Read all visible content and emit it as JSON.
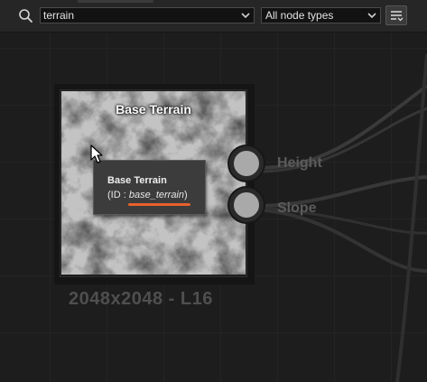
{
  "toolbar": {
    "search": {
      "value": "terrain",
      "icon": "search-icon"
    },
    "node_type_filter": {
      "selected": "All node types"
    },
    "filter_options_icon": "filter-list-icon"
  },
  "graph": {
    "node": {
      "title": "Base Terrain",
      "resolution": "2048x2048 - L16",
      "ports": [
        {
          "label": "Height"
        },
        {
          "label": "Slope"
        }
      ]
    },
    "tooltip": {
      "title": "Base Terrain",
      "id_prefix": "(ID : ",
      "id_value": "base_terrain",
      "id_suffix": ")",
      "highlight_color": "#e8612c"
    }
  },
  "colors": {
    "background": "#1d1d1d",
    "toolbar": "#262626",
    "port": "#a9a9a9",
    "port_label": "#5b5b5b"
  }
}
